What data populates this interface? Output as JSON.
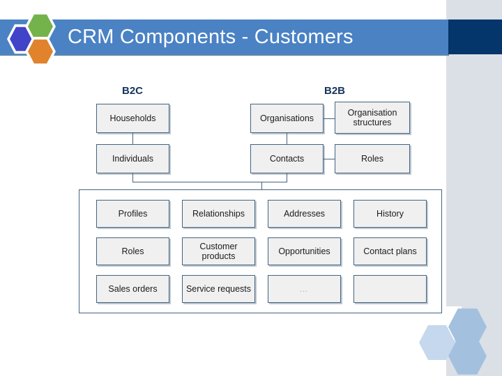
{
  "slide": {
    "title": "CRM Components - Customers",
    "logo": {
      "hex_blue": "#4143c8",
      "hex_green": "#74b24c",
      "hex_orange": "#e1822c"
    },
    "theme": {
      "header_band": "#4a82c4",
      "header_dark": "#04356b",
      "right_band": "#dbe0e6",
      "node_fill": "#f0f0f0",
      "node_border": "#44637f",
      "group_label_color": "#16335c",
      "deco_hex_light": "#c5d8ed",
      "deco_hex_dark": "#a3c0de"
    }
  },
  "diagram": {
    "groups": [
      {
        "label": "B2C"
      },
      {
        "label": "B2B"
      }
    ],
    "b2c_nodes": [
      {
        "label": "Households"
      },
      {
        "label": "Individuals"
      }
    ],
    "b2b_nodes": [
      {
        "label": "Organisations"
      },
      {
        "label": "Organisation structures"
      },
      {
        "label": "Contacts"
      },
      {
        "label": "Roles"
      }
    ],
    "attribute_grid": {
      "rows": [
        [
          {
            "label": "Profiles"
          },
          {
            "label": "Relationships"
          },
          {
            "label": "Addresses"
          },
          {
            "label": "History"
          }
        ],
        [
          {
            "label": "Roles"
          },
          {
            "label": "Customer products"
          },
          {
            "label": "Opportunities"
          },
          {
            "label": "Contact plans"
          }
        ],
        [
          {
            "label": "Sales orders"
          },
          {
            "label": "Service requests"
          },
          {
            "label": "…"
          },
          {
            "label": ""
          }
        ]
      ]
    }
  }
}
